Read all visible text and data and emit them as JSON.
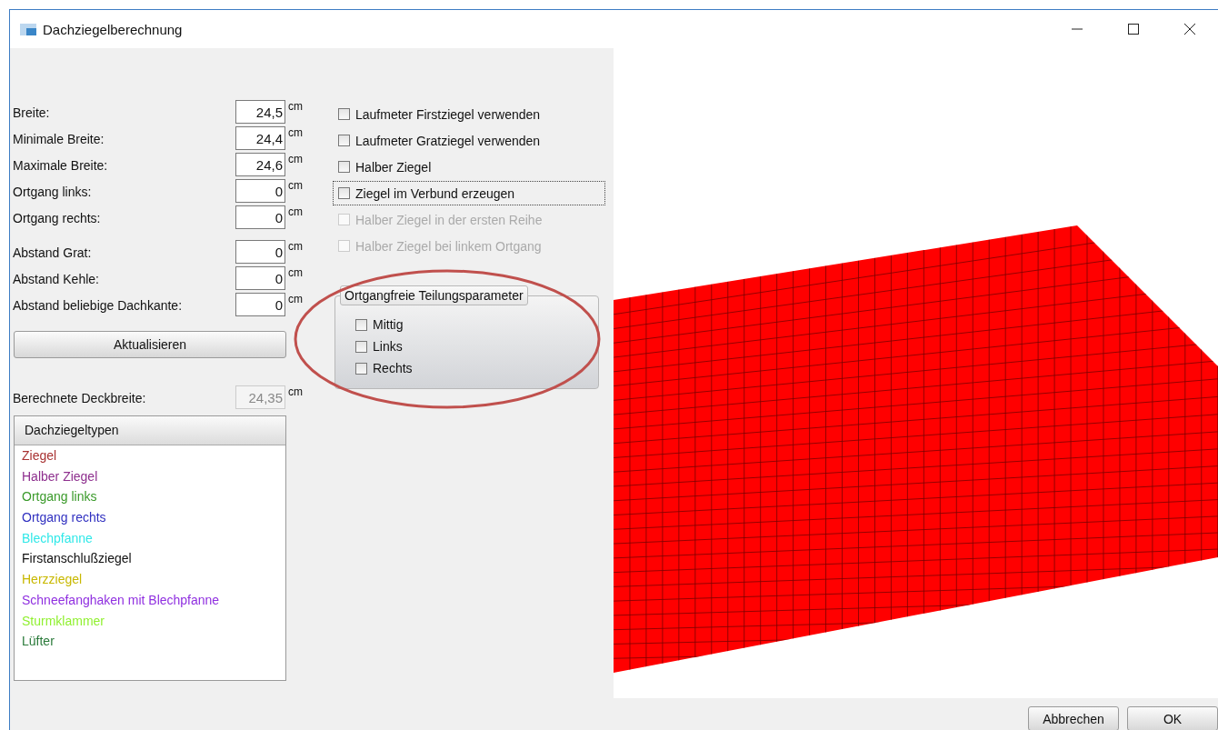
{
  "window": {
    "title": "Dachziegelberechnung"
  },
  "field_groups": [
    [
      {
        "label": "Breite:",
        "value": "24,5",
        "unit": "cm"
      },
      {
        "label": "Minimale Breite:",
        "value": "24,4",
        "unit": "cm"
      },
      {
        "label": "Maximale Breite:",
        "value": "24,6",
        "unit": "cm"
      },
      {
        "label": "Ortgang links:",
        "value": "0",
        "unit": "cm"
      },
      {
        "label": "Ortgang rechts:",
        "value": "0",
        "unit": "cm"
      }
    ],
    [
      {
        "label": "Abstand Grat:",
        "value": "0",
        "unit": "cm"
      },
      {
        "label": "Abstand Kehle:",
        "value": "0",
        "unit": "cm"
      },
      {
        "label": "Abstand beliebige Dachkante:",
        "value": "0",
        "unit": "cm"
      }
    ]
  ],
  "update_button": "Aktualisieren",
  "computed": {
    "label": "Berechnete Deckbreite:",
    "value": "24,35",
    "unit": "cm",
    "disabled": true
  },
  "types_list": {
    "header": "Dachziegeltypen",
    "items": [
      {
        "label": "Ziegel",
        "color": "#a83232"
      },
      {
        "label": "Halber Ziegel",
        "color": "#8e2f8e"
      },
      {
        "label": "Ortgang links",
        "color": "#3a9a2a"
      },
      {
        "label": "Ortgang rechts",
        "color": "#3030c0"
      },
      {
        "label": "Blechpfanne",
        "color": "#30e8e8"
      },
      {
        "label": "Firstanschlußziegel",
        "color": "#101010"
      },
      {
        "label": "Herzziegel",
        "color": "#c8b800"
      },
      {
        "label": "Schneefanghaken mit Blechpfanne",
        "color": "#9030e0"
      },
      {
        "label": "Sturmklammer",
        "color": "#90f030"
      },
      {
        "label": "Lüfter",
        "color": "#2a7a3a"
      }
    ]
  },
  "options": [
    {
      "label": "Laufmeter Firstziegel verwenden",
      "checked": false,
      "disabled": false,
      "focused": false
    },
    {
      "label": "Laufmeter Gratziegel verwenden",
      "checked": false,
      "disabled": false,
      "focused": false
    },
    {
      "label": "Halber Ziegel",
      "checked": false,
      "disabled": false,
      "focused": false
    },
    {
      "label": "Ziegel im Verbund erzeugen",
      "checked": false,
      "disabled": false,
      "focused": true
    },
    {
      "label": "Halber Ziegel in der ersten Reihe",
      "checked": false,
      "disabled": true,
      "focused": false
    },
    {
      "label": "Halber Ziegel bei linkem Ortgang",
      "checked": false,
      "disabled": true,
      "focused": false
    }
  ],
  "division_group": {
    "title": "Ortgangfreie Teilungsparameter",
    "options": [
      {
        "label": "Mittig",
        "checked": false
      },
      {
        "label": "Links",
        "checked": false
      },
      {
        "label": "Rechts",
        "checked": false
      }
    ]
  },
  "buttons": [
    {
      "label": "Abbrechen"
    },
    {
      "label": "OK"
    }
  ]
}
